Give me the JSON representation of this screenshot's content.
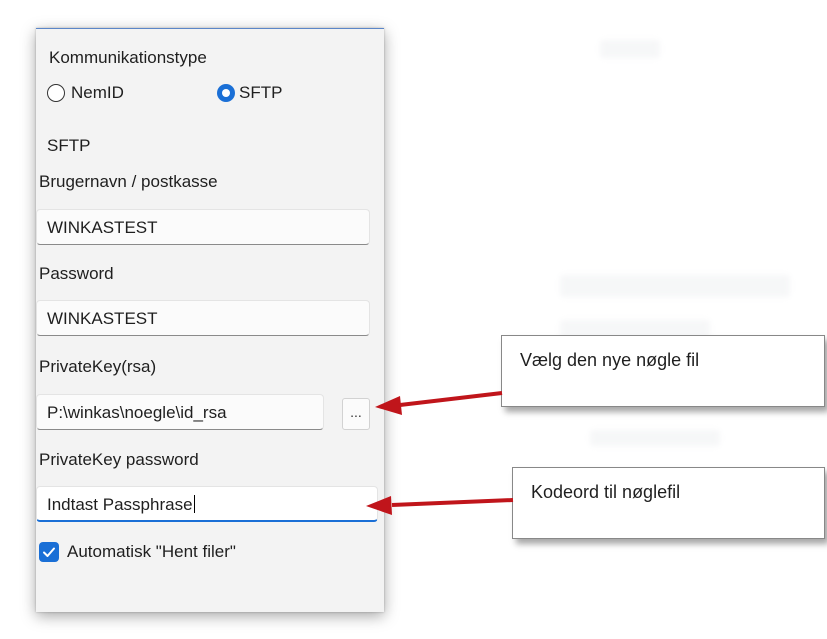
{
  "dialog": {
    "communication_type_label": "Kommunikationstype",
    "radio_options": [
      {
        "label": "NemID",
        "selected": false
      },
      {
        "label": "SFTP",
        "selected": true
      }
    ],
    "sftp_section_label": "SFTP",
    "username_label": "Brugernavn / postkasse",
    "username_value": "WINKASTEST",
    "password_label": "Password",
    "password_value": "WINKASTEST",
    "private_key_label": "PrivateKey(rsa)",
    "private_key_value": "P:\\winkas\\noegle\\id_rsa",
    "browse_label": "...",
    "private_key_password_label": "PrivateKey password",
    "private_key_password_value": "Indtast Passphrase",
    "auto_fetch_label": "Automatisk \"Hent filer\"",
    "auto_fetch_checked": true
  },
  "callouts": {
    "choose_key_file": "Vælg den nye nøgle fil",
    "key_file_password": "Kodeord til nøglefil"
  },
  "colors": {
    "accent": "#1a6fd6",
    "arrow": "#c0151b",
    "panel_bg": "#f3f3f3"
  }
}
